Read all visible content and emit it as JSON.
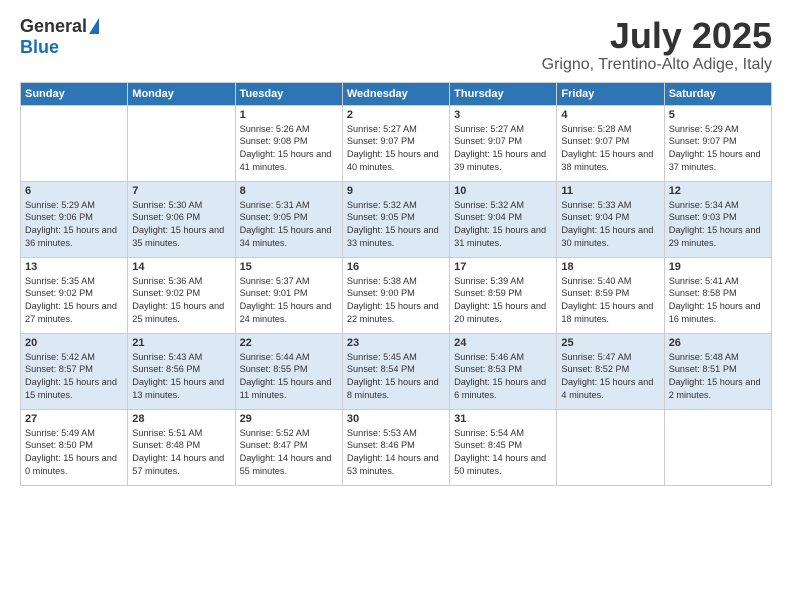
{
  "logo": {
    "general": "General",
    "blue": "Blue"
  },
  "title": "July 2025",
  "subtitle": "Grigno, Trentino-Alto Adige, Italy",
  "days_of_week": [
    "Sunday",
    "Monday",
    "Tuesday",
    "Wednesday",
    "Thursday",
    "Friday",
    "Saturday"
  ],
  "weeks": [
    [
      {
        "day": "",
        "info": ""
      },
      {
        "day": "",
        "info": ""
      },
      {
        "day": "1",
        "info": "Sunrise: 5:26 AM\nSunset: 9:08 PM\nDaylight: 15 hours and 41 minutes."
      },
      {
        "day": "2",
        "info": "Sunrise: 5:27 AM\nSunset: 9:07 PM\nDaylight: 15 hours and 40 minutes."
      },
      {
        "day": "3",
        "info": "Sunrise: 5:27 AM\nSunset: 9:07 PM\nDaylight: 15 hours and 39 minutes."
      },
      {
        "day": "4",
        "info": "Sunrise: 5:28 AM\nSunset: 9:07 PM\nDaylight: 15 hours and 38 minutes."
      },
      {
        "day": "5",
        "info": "Sunrise: 5:29 AM\nSunset: 9:07 PM\nDaylight: 15 hours and 37 minutes."
      }
    ],
    [
      {
        "day": "6",
        "info": "Sunrise: 5:29 AM\nSunset: 9:06 PM\nDaylight: 15 hours and 36 minutes."
      },
      {
        "day": "7",
        "info": "Sunrise: 5:30 AM\nSunset: 9:06 PM\nDaylight: 15 hours and 35 minutes."
      },
      {
        "day": "8",
        "info": "Sunrise: 5:31 AM\nSunset: 9:05 PM\nDaylight: 15 hours and 34 minutes."
      },
      {
        "day": "9",
        "info": "Sunrise: 5:32 AM\nSunset: 9:05 PM\nDaylight: 15 hours and 33 minutes."
      },
      {
        "day": "10",
        "info": "Sunrise: 5:32 AM\nSunset: 9:04 PM\nDaylight: 15 hours and 31 minutes."
      },
      {
        "day": "11",
        "info": "Sunrise: 5:33 AM\nSunset: 9:04 PM\nDaylight: 15 hours and 30 minutes."
      },
      {
        "day": "12",
        "info": "Sunrise: 5:34 AM\nSunset: 9:03 PM\nDaylight: 15 hours and 29 minutes."
      }
    ],
    [
      {
        "day": "13",
        "info": "Sunrise: 5:35 AM\nSunset: 9:02 PM\nDaylight: 15 hours and 27 minutes."
      },
      {
        "day": "14",
        "info": "Sunrise: 5:36 AM\nSunset: 9:02 PM\nDaylight: 15 hours and 25 minutes."
      },
      {
        "day": "15",
        "info": "Sunrise: 5:37 AM\nSunset: 9:01 PM\nDaylight: 15 hours and 24 minutes."
      },
      {
        "day": "16",
        "info": "Sunrise: 5:38 AM\nSunset: 9:00 PM\nDaylight: 15 hours and 22 minutes."
      },
      {
        "day": "17",
        "info": "Sunrise: 5:39 AM\nSunset: 8:59 PM\nDaylight: 15 hours and 20 minutes."
      },
      {
        "day": "18",
        "info": "Sunrise: 5:40 AM\nSunset: 8:59 PM\nDaylight: 15 hours and 18 minutes."
      },
      {
        "day": "19",
        "info": "Sunrise: 5:41 AM\nSunset: 8:58 PM\nDaylight: 15 hours and 16 minutes."
      }
    ],
    [
      {
        "day": "20",
        "info": "Sunrise: 5:42 AM\nSunset: 8:57 PM\nDaylight: 15 hours and 15 minutes."
      },
      {
        "day": "21",
        "info": "Sunrise: 5:43 AM\nSunset: 8:56 PM\nDaylight: 15 hours and 13 minutes."
      },
      {
        "day": "22",
        "info": "Sunrise: 5:44 AM\nSunset: 8:55 PM\nDaylight: 15 hours and 11 minutes."
      },
      {
        "day": "23",
        "info": "Sunrise: 5:45 AM\nSunset: 8:54 PM\nDaylight: 15 hours and 8 minutes."
      },
      {
        "day": "24",
        "info": "Sunrise: 5:46 AM\nSunset: 8:53 PM\nDaylight: 15 hours and 6 minutes."
      },
      {
        "day": "25",
        "info": "Sunrise: 5:47 AM\nSunset: 8:52 PM\nDaylight: 15 hours and 4 minutes."
      },
      {
        "day": "26",
        "info": "Sunrise: 5:48 AM\nSunset: 8:51 PM\nDaylight: 15 hours and 2 minutes."
      }
    ],
    [
      {
        "day": "27",
        "info": "Sunrise: 5:49 AM\nSunset: 8:50 PM\nDaylight: 15 hours and 0 minutes."
      },
      {
        "day": "28",
        "info": "Sunrise: 5:51 AM\nSunset: 8:48 PM\nDaylight: 14 hours and 57 minutes."
      },
      {
        "day": "29",
        "info": "Sunrise: 5:52 AM\nSunset: 8:47 PM\nDaylight: 14 hours and 55 minutes."
      },
      {
        "day": "30",
        "info": "Sunrise: 5:53 AM\nSunset: 8:46 PM\nDaylight: 14 hours and 53 minutes."
      },
      {
        "day": "31",
        "info": "Sunrise: 5:54 AM\nSunset: 8:45 PM\nDaylight: 14 hours and 50 minutes."
      },
      {
        "day": "",
        "info": ""
      },
      {
        "day": "",
        "info": ""
      }
    ]
  ]
}
